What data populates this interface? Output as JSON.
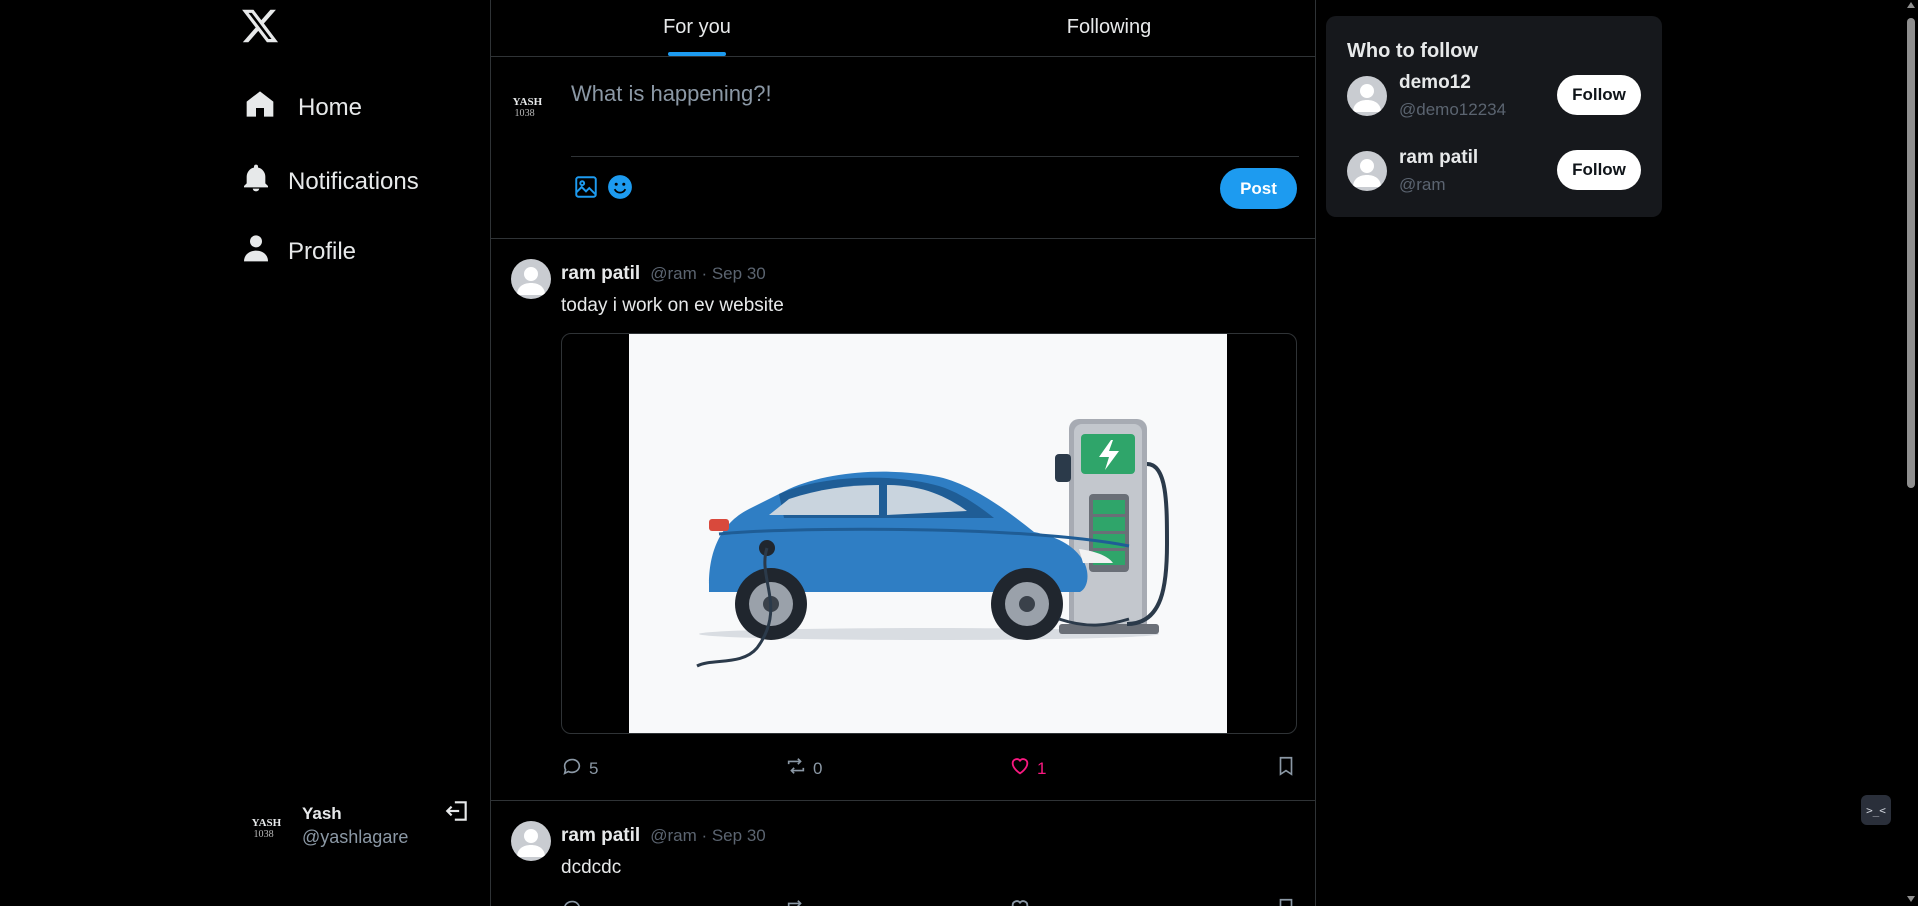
{
  "nav": {
    "logo": "x-logo",
    "items": [
      {
        "label": "Home",
        "icon": "home-icon"
      },
      {
        "label": "Notifications",
        "icon": "bell-icon"
      },
      {
        "label": "Profile",
        "icon": "user-icon"
      }
    ]
  },
  "account": {
    "avatar_text": "YASH",
    "name": "Yash",
    "handle": "@yashlagare"
  },
  "tabs": [
    {
      "label": "For you",
      "active": true
    },
    {
      "label": "Following",
      "active": false
    }
  ],
  "composer": {
    "avatar_text": "YASH",
    "placeholder": "What is happening?!",
    "post_label": "Post"
  },
  "tweets": [
    {
      "name": "ram patil",
      "meta": "@ram · Sep 30",
      "text": "today i work on ev website",
      "replies": "5",
      "retweets": "0",
      "likes": "1",
      "liked": true
    },
    {
      "name": "ram patil",
      "meta": "@ram · Sep 30",
      "text": "dcdcdc"
    }
  ],
  "who_to_follow": {
    "title": "Who to follow",
    "users": [
      {
        "name": "demo12",
        "handle": "@demo12234",
        "button": "Follow"
      },
      {
        "name": "ram patil",
        "handle": "@ram",
        "button": "Follow"
      }
    ]
  },
  "colors": {
    "accent": "#1d9bf0",
    "like": "#f91880",
    "background": "#000000",
    "panel": "#16181c"
  }
}
